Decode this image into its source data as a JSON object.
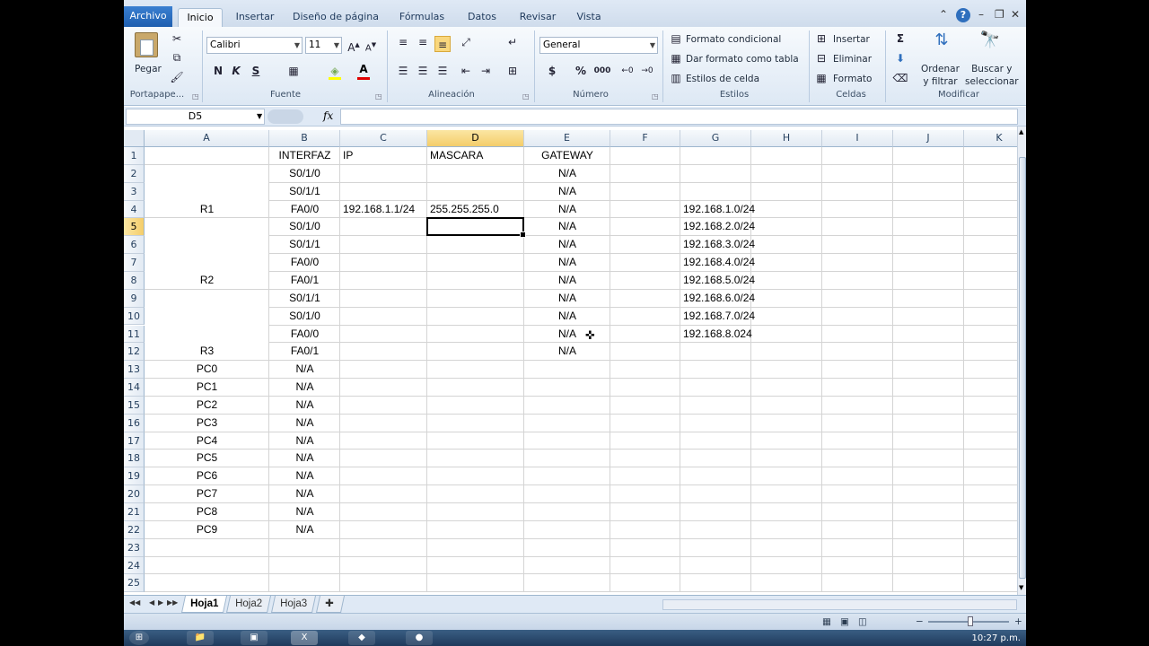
{
  "ribbon": {
    "file_tab": "Archivo",
    "tabs": [
      "Inicio",
      "Insertar",
      "Diseño de página",
      "Fórmulas",
      "Datos",
      "Revisar",
      "Vista"
    ],
    "active_tab": "Inicio",
    "clipboard": {
      "paste": "Pegar",
      "group": "Portapape..."
    },
    "font": {
      "name": "Calibri",
      "size": "11",
      "bold": "N",
      "italic": "K",
      "underline": "S",
      "group": "Fuente"
    },
    "alignment": {
      "group": "Alineación"
    },
    "number": {
      "format": "General",
      "currency": "$",
      "percent": "%",
      "thousands": "000",
      "group": "Número"
    },
    "styles": {
      "conditional": "Formato condicional",
      "table": "Dar formato como tabla",
      "cell_styles": "Estilos de celda",
      "group": "Estilos"
    },
    "cells": {
      "insert": "Insertar",
      "delete": "Eliminar",
      "format": "Formato",
      "group": "Celdas"
    },
    "editing": {
      "sum": "Σ",
      "sort_line1": "Ordenar",
      "sort_line2": "y filtrar",
      "find_line1": "Buscar y",
      "find_line2": "seleccionar",
      "group": "Modificar"
    }
  },
  "formula_bar": {
    "name_box": "D5",
    "fx": "fx",
    "value": ""
  },
  "columns": [
    "A",
    "B",
    "C",
    "D",
    "E",
    "F",
    "G",
    "H",
    "I",
    "J",
    "K"
  ],
  "selected_column": "D",
  "selected_row": "5",
  "rows": [
    {
      "n": "1",
      "A": "",
      "B": "INTERFAZ",
      "C": "IP",
      "D": "MASCARA",
      "E": "GATEWAY",
      "G": ""
    },
    {
      "n": "2",
      "A": "",
      "B": "S0/1/0",
      "C": "",
      "D": "",
      "E": "N/A",
      "G": ""
    },
    {
      "n": "3",
      "A": "",
      "B": "S0/1/1",
      "C": "",
      "D": "",
      "E": "N/A",
      "G": ""
    },
    {
      "n": "4",
      "A": "R1",
      "B": "FA0/0",
      "C": "192.168.1.1/24",
      "D": "255.255.255.0",
      "E": "N/A",
      "G": "192.168.1.0/24"
    },
    {
      "n": "5",
      "A": "",
      "B": "S0/1/0",
      "C": "",
      "D": "",
      "E": "N/A",
      "G": "192.168.2.0/24"
    },
    {
      "n": "6",
      "A": "",
      "B": "S0/1/1",
      "C": "",
      "D": "",
      "E": "N/A",
      "G": "192.168.3.0/24"
    },
    {
      "n": "7",
      "A": "",
      "B": "FA0/0",
      "C": "",
      "D": "",
      "E": "N/A",
      "G": "192.168.4.0/24"
    },
    {
      "n": "8",
      "A": "R2",
      "B": "FA0/1",
      "C": "",
      "D": "",
      "E": "N/A",
      "G": "192.168.5.0/24"
    },
    {
      "n": "9",
      "A": "",
      "B": "S0/1/1",
      "C": "",
      "D": "",
      "E": "N/A",
      "G": "192.168.6.0/24"
    },
    {
      "n": "10",
      "A": "",
      "B": "S0/1/0",
      "C": "",
      "D": "",
      "E": "N/A",
      "G": "192.168.7.0/24"
    },
    {
      "n": "11",
      "A": "",
      "B": "FA0/0",
      "C": "",
      "D": "",
      "E": "N/A",
      "G": "192.168.8.024"
    },
    {
      "n": "12",
      "A": "R3",
      "B": "FA0/1",
      "C": "",
      "D": "",
      "E": "N/A",
      "G": ""
    },
    {
      "n": "13",
      "A": "PC0",
      "B": "N/A",
      "C": "",
      "D": "",
      "E": "",
      "G": ""
    },
    {
      "n": "14",
      "A": "PC1",
      "B": "N/A",
      "C": "",
      "D": "",
      "E": "",
      "G": ""
    },
    {
      "n": "15",
      "A": "PC2",
      "B": "N/A",
      "C": "",
      "D": "",
      "E": "",
      "G": ""
    },
    {
      "n": "16",
      "A": "PC3",
      "B": "N/A",
      "C": "",
      "D": "",
      "E": "",
      "G": ""
    },
    {
      "n": "17",
      "A": "PC4",
      "B": "N/A",
      "C": "",
      "D": "",
      "E": "",
      "G": ""
    },
    {
      "n": "18",
      "A": "PC5",
      "B": "N/A",
      "C": "",
      "D": "",
      "E": "",
      "G": ""
    },
    {
      "n": "19",
      "A": "PC6",
      "B": "N/A",
      "C": "",
      "D": "",
      "E": "",
      "G": ""
    },
    {
      "n": "20",
      "A": "PC7",
      "B": "N/A",
      "C": "",
      "D": "",
      "E": "",
      "G": ""
    },
    {
      "n": "21",
      "A": "PC8",
      "B": "N/A",
      "C": "",
      "D": "",
      "E": "",
      "G": ""
    },
    {
      "n": "22",
      "A": "PC9",
      "B": "N/A",
      "C": "",
      "D": "",
      "E": "",
      "G": ""
    },
    {
      "n": "23",
      "A": "",
      "B": "",
      "C": "",
      "D": "",
      "E": "",
      "G": ""
    },
    {
      "n": "24",
      "A": "",
      "B": "",
      "C": "",
      "D": "",
      "E": "",
      "G": ""
    },
    {
      "n": "25",
      "A": "",
      "B": "",
      "C": "",
      "D": "",
      "E": "",
      "G": ""
    }
  ],
  "sheets": [
    "Hoja1",
    "Hoja2",
    "Hoja3"
  ],
  "active_sheet": "Hoja1",
  "status": {
    "zoom_minus": "−",
    "zoom_plus": "+"
  },
  "taskbar": {
    "clock": "10:27 p.m."
  },
  "colors": {
    "accent": "#2b579a",
    "selected_header": "#f4cd6a",
    "file_tab": "#1f5fb0"
  }
}
